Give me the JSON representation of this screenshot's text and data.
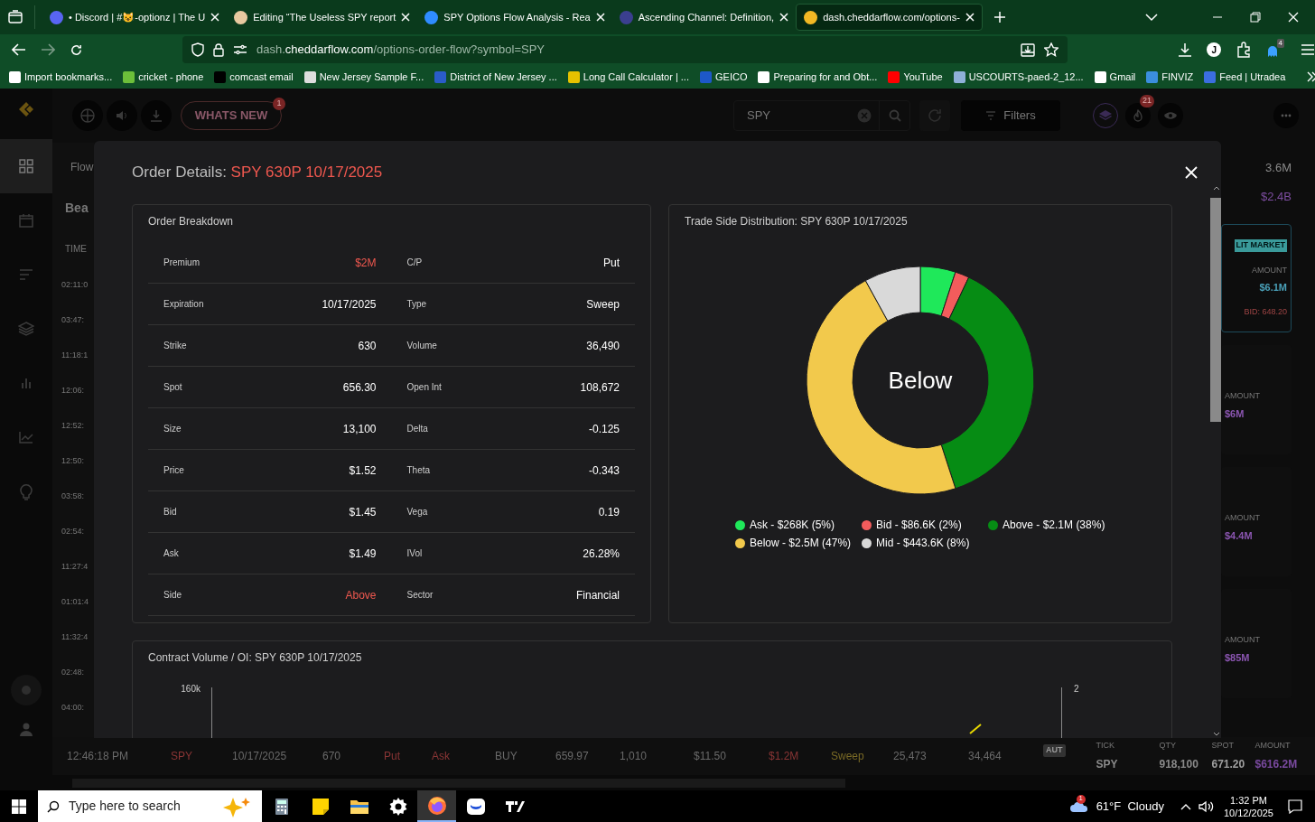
{
  "browser": {
    "tabs": [
      {
        "title": "• Discord | #😺-optionz | The U",
        "color": "#5865f2",
        "selected": false
      },
      {
        "title": "Editing “The Useless SPY report",
        "color": "#e8c9a0",
        "selected": false
      },
      {
        "title": "SPY Options Flow Analysis - Rea",
        "color": "#2f8cff",
        "selected": false
      },
      {
        "title": "Ascending Channel: Definition, ",
        "color": "#3b3f8f",
        "selected": false
      },
      {
        "title": "dash.cheddarflow.com/options-",
        "color": "#f2b824",
        "selected": true
      }
    ],
    "address": {
      "prefix": "dash.",
      "domain": "cheddarflow.com",
      "path": "/options-order-flow?symbol=SPY"
    },
    "profile_initial": "J",
    "extension_badge": "4",
    "bookmarks": [
      {
        "label": "Import bookmarks...",
        "color": "#ffffff"
      },
      {
        "label": "cricket - phone",
        "color": "#6cbf3a"
      },
      {
        "label": "comcast email",
        "color": "#000000"
      },
      {
        "label": "New Jersey Sample F...",
        "color": "#dddddd"
      },
      {
        "label": "District of New Jersey ...",
        "color": "#2a5cc8"
      },
      {
        "label": "Long Call Calculator | ...",
        "color": "#e6c200"
      },
      {
        "label": "GEICO",
        "color": "#1d58c8"
      },
      {
        "label": "Preparing for and Obt...",
        "color": "#ffffff"
      },
      {
        "label": "YouTube",
        "color": "#ff0000"
      },
      {
        "label": "USCOURTS-paed-2_12...",
        "color": "#8fb0d8"
      },
      {
        "label": "Gmail",
        "color": "#ffffff"
      },
      {
        "label": "FINVIZ",
        "color": "#3b8ede"
      },
      {
        "label": "Feed | Utradea",
        "color": "#3b6ee0"
      }
    ]
  },
  "sidebar": {
    "items": [
      {
        "kind": "grid",
        "selected": true
      },
      {
        "kind": "calendar",
        "selected": false
      },
      {
        "kind": "list",
        "selected": false
      },
      {
        "kind": "layers",
        "selected": false
      },
      {
        "kind": "bars",
        "selected": false
      },
      {
        "kind": "line",
        "selected": false
      },
      {
        "kind": "bulb",
        "selected": false
      }
    ]
  },
  "toolbar": {
    "whats_new": "WHATS NEW",
    "whats_new_badge": "1",
    "search_value": "SPY",
    "filters": "Filters",
    "alerts_badge": "21"
  },
  "background": {
    "tab_label": "Flow",
    "heading": "Bea",
    "time_header": "TIME",
    "times": [
      "02:11:0",
      "03:47:",
      "11:18:1",
      "12:06:",
      "12:52:",
      "12:50:",
      "03:58:",
      "02:54:",
      "11:27:4",
      "01:01:4",
      "11:32:4",
      "02:48:",
      "04:00:"
    ],
    "stats": [
      {
        "value": "3.6M",
        "color": "#8a8a8a"
      },
      {
        "value": "$2.4B",
        "color": "#7d4da0"
      }
    ],
    "lit_card": {
      "badge": "LIT MARKET",
      "label": "AMOUNT",
      "amount": "$6.1M",
      "bid": "BID: 648.20"
    },
    "cards": [
      {
        "label": "AMOUNT",
        "amount": "$6M"
      },
      {
        "label": "AMOUNT",
        "amount": "$4.4M"
      },
      {
        "label": "AMOUNT",
        "amount": "$85M"
      }
    ],
    "bottom_row": [
      {
        "text": "12:46:18 PM",
        "color": "#6a6a6a"
      },
      {
        "text": "SPY",
        "color": "#8a3535"
      },
      {
        "text": "10/17/2025",
        "color": "#6a6a6a"
      },
      {
        "text": "670",
        "color": "#6a6a6a"
      },
      {
        "text": "Put",
        "color": "#8a3535"
      },
      {
        "text": "Ask",
        "color": "#8a3535"
      },
      {
        "text": "BUY",
        "color": "#6a6a6a"
      },
      {
        "text": "659.97",
        "color": "#6a6a6a"
      },
      {
        "text": "1,010",
        "color": "#6a6a6a"
      },
      {
        "text": "$11.50",
        "color": "#6a6a6a"
      },
      {
        "text": "$1.2M",
        "color": "#8a3535"
      },
      {
        "text": "Sweep",
        "color": "#7a6a25"
      },
      {
        "text": "25,473",
        "color": "#6a6a6a"
      },
      {
        "text": "34,464",
        "color": "#6a6a6a"
      }
    ],
    "bottom_badge": "AUT",
    "summary": {
      "headers": [
        "TICK",
        "QTY",
        "SPOT",
        "AMOUNT"
      ],
      "values": [
        {
          "text": "SPY",
          "color": "#8a8a8a"
        },
        {
          "text": "918,100",
          "color": "#8a8a8a"
        },
        {
          "text": "671.20",
          "color": "#a0a0a0"
        },
        {
          "text": "$616.2M",
          "color": "#7a4aa0"
        }
      ]
    }
  },
  "modal": {
    "title": "Order Details:",
    "contract": "SPY 630P 10/17/2025",
    "breakdown": {
      "title": "Order Breakdown",
      "fields": [
        {
          "label": "Premium",
          "value": "$2M",
          "highlight": true
        },
        {
          "label": "C/P",
          "value": "Put",
          "highlight": false
        },
        {
          "label": "Expiration",
          "value": "10/17/2025",
          "highlight": false
        },
        {
          "label": "Type",
          "value": "Sweep",
          "highlight": false
        },
        {
          "label": "Strike",
          "value": "630",
          "highlight": false
        },
        {
          "label": "Volume",
          "value": "36,490",
          "highlight": false
        },
        {
          "label": "Spot",
          "value": "656.30",
          "highlight": false
        },
        {
          "label": "Open Int",
          "value": "108,672",
          "highlight": false
        },
        {
          "label": "Size",
          "value": "13,100",
          "highlight": false
        },
        {
          "label": "Delta",
          "value": "-0.125",
          "highlight": false
        },
        {
          "label": "Price",
          "value": "$1.52",
          "highlight": false
        },
        {
          "label": "Theta",
          "value": "-0.343",
          "highlight": false
        },
        {
          "label": "Bid",
          "value": "$1.45",
          "highlight": false
        },
        {
          "label": "Vega",
          "value": "0.19",
          "highlight": false
        },
        {
          "label": "Ask",
          "value": "$1.49",
          "highlight": false
        },
        {
          "label": "IVol",
          "value": "26.28%",
          "highlight": false
        },
        {
          "label": "Side",
          "value": "Above",
          "highlight": true
        },
        {
          "label": "Sector",
          "value": "Financial",
          "highlight": false
        }
      ]
    },
    "distribution": {
      "title": "Trade Side Distribution: SPY 630P 10/17/2025",
      "center_label": "Below",
      "chart_data": {
        "type": "donut",
        "categories": [
          "Ask - $268K (5%)",
          "Bid - $86.6K (2%)",
          "Above - $2.1M (38%)",
          "Below - $2.5M (47%)",
          "Mid - $443.6K (8%)"
        ],
        "series": [
          {
            "values": [
              5,
              2,
              38,
              47,
              8
            ]
          }
        ],
        "colors": [
          "#1fe85a",
          "#f25c5c",
          "#068c14",
          "#f2c94c",
          "#d9d9d9"
        ]
      }
    },
    "volume": {
      "title": "Contract Volume / OI: SPY 630P 10/17/2025",
      "left_tick": "160k",
      "right_tick": "2"
    }
  },
  "taskbar": {
    "search_placeholder": "Type here to search",
    "weather_badge": "1",
    "weather": "61°F  Cloudy",
    "time": "1:32 PM",
    "date": "10/12/2025"
  }
}
